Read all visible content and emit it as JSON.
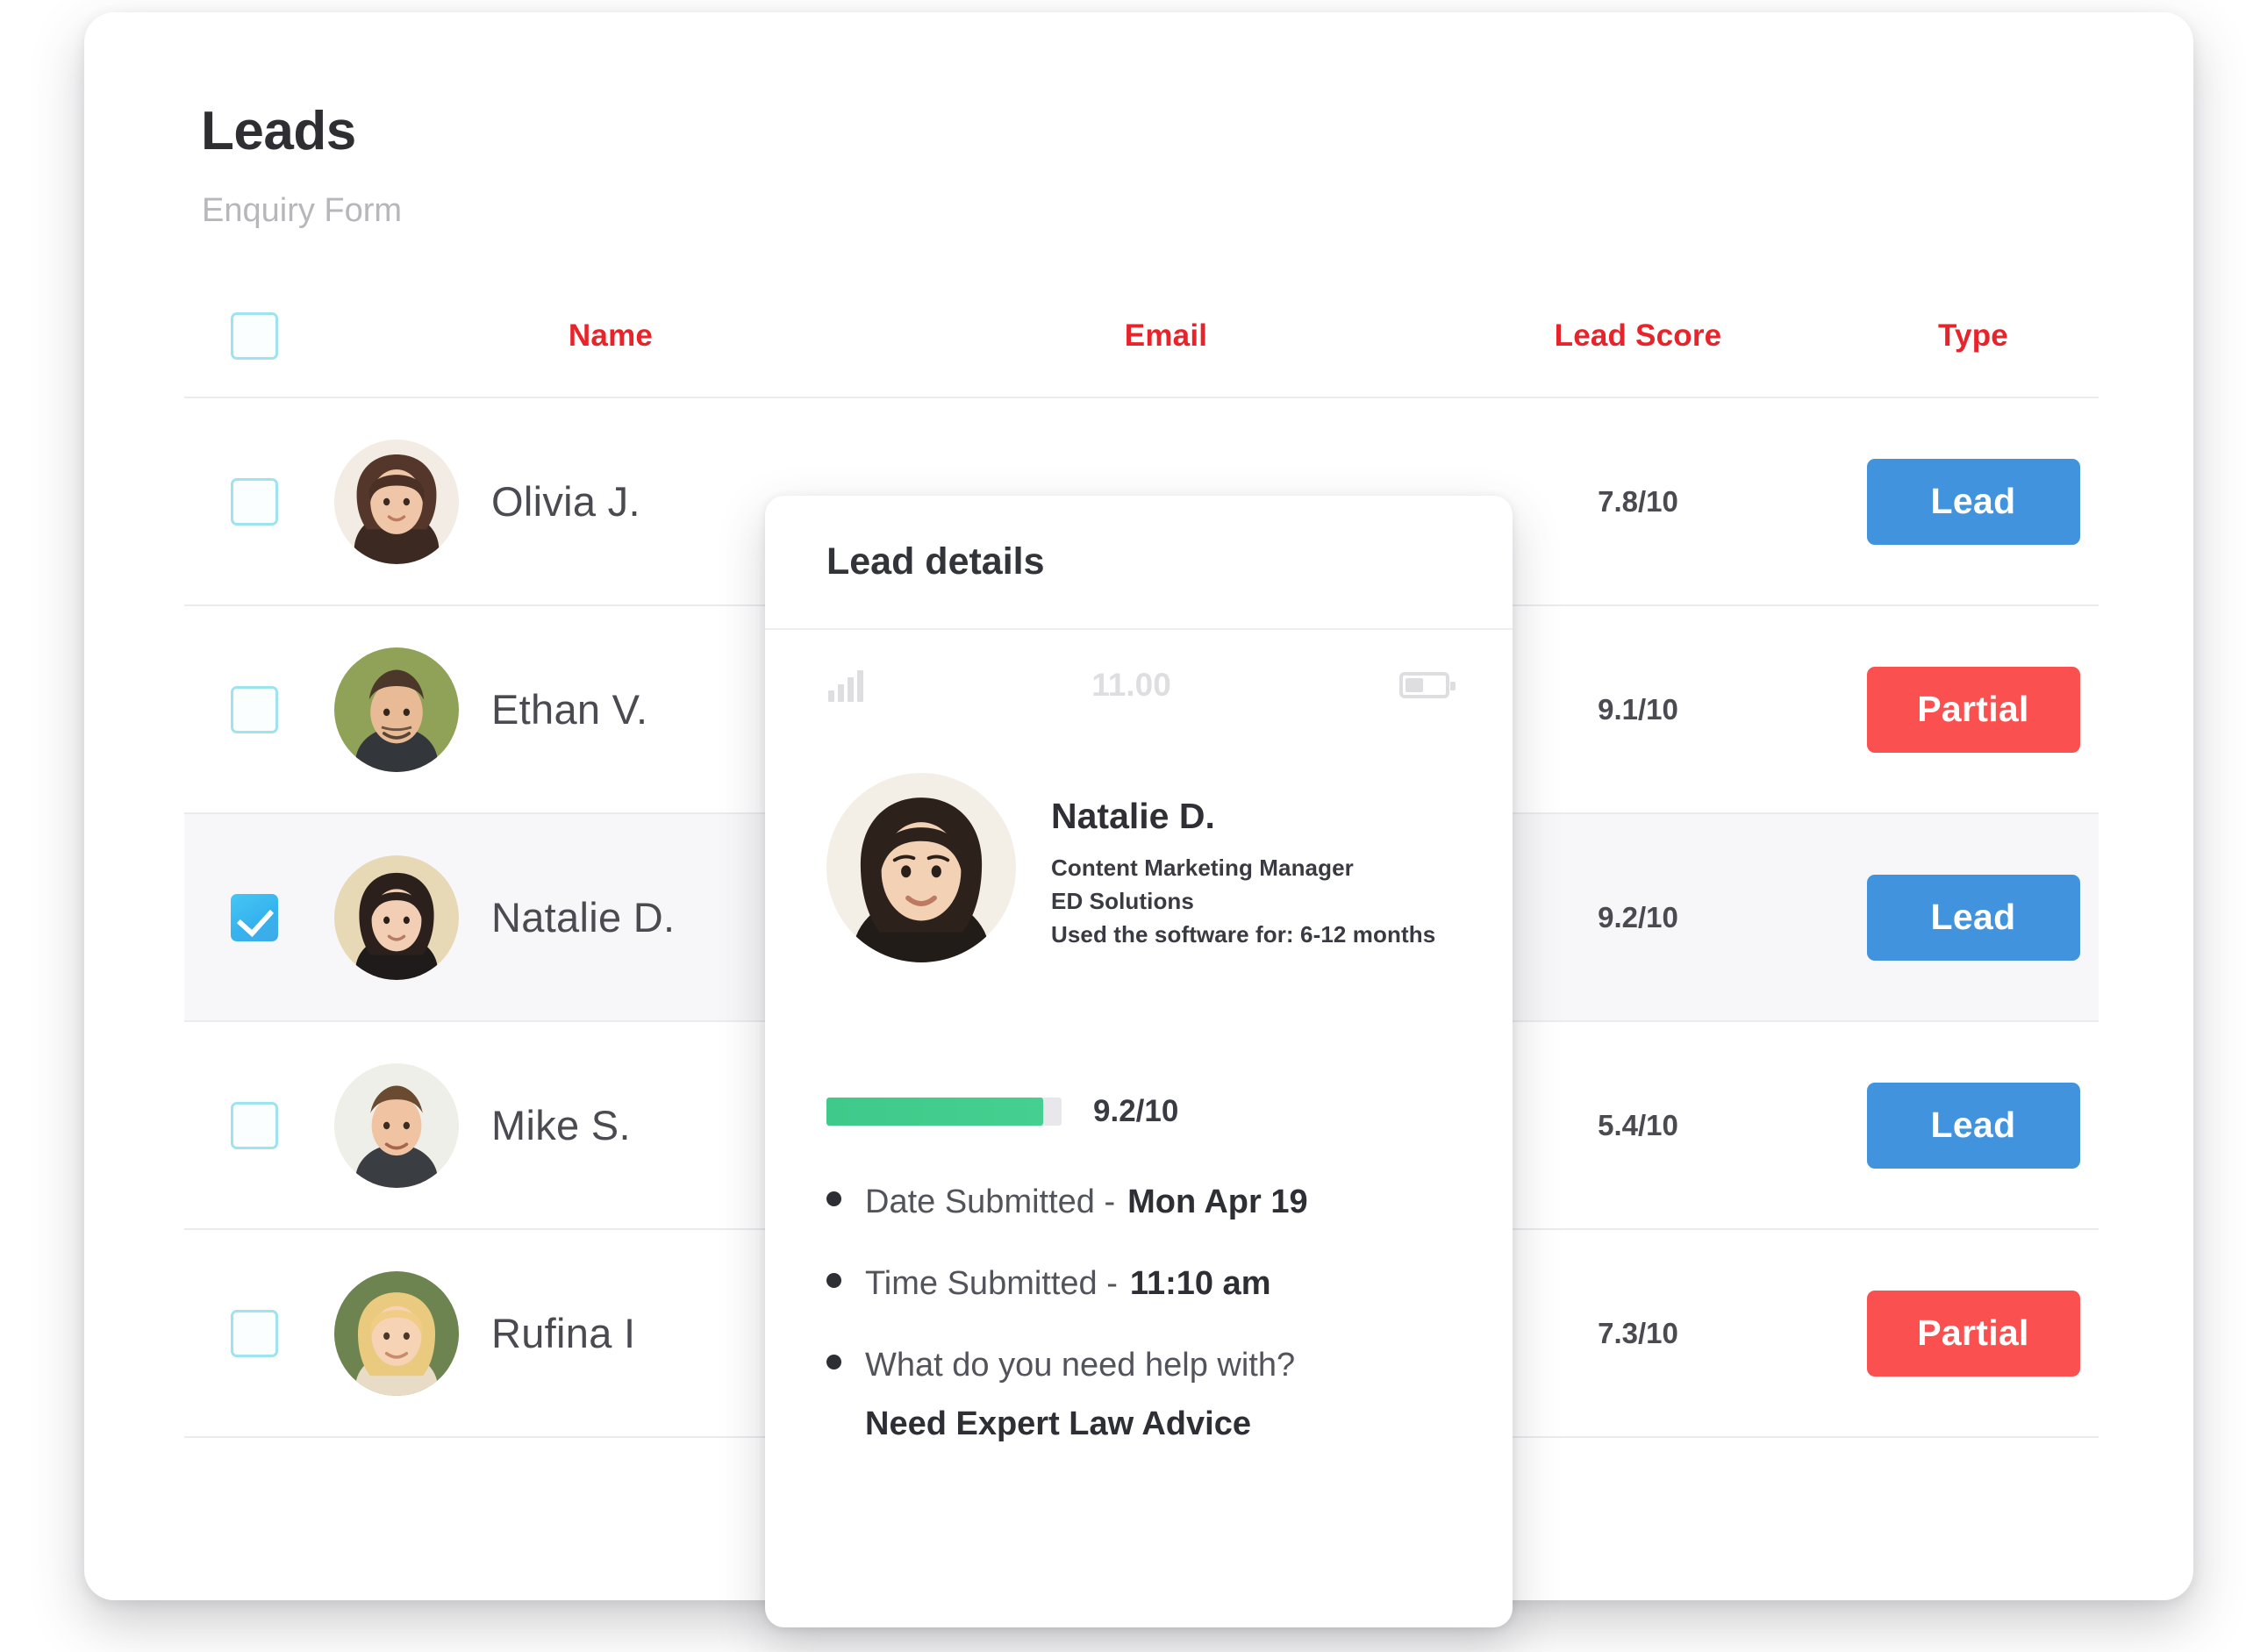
{
  "header": {
    "title": "Leads",
    "subtitle": "Enquiry Form"
  },
  "colors": {
    "header_text": "#e8232a",
    "badge_lead": "#4193dd",
    "badge_partial": "#fa5150",
    "checkbox_checked": "#36b3ee",
    "score_bar": "#3fc98a"
  },
  "table": {
    "columns": [
      "Name",
      "Email",
      "Lead Score",
      "Type"
    ],
    "select_all_checked": false,
    "rows": [
      {
        "name": "Olivia J.",
        "email": "",
        "score": "7.8/10",
        "type": "Lead",
        "checked": false,
        "selected": false
      },
      {
        "name": "Ethan V.",
        "email": "",
        "score": "9.1/10",
        "type": "Partial",
        "checked": false,
        "selected": false
      },
      {
        "name": "Natalie D.",
        "email": "",
        "score": "9.2/10",
        "type": "Lead",
        "checked": true,
        "selected": true
      },
      {
        "name": "Mike S.",
        "email": "",
        "score": "5.4/10",
        "type": "Lead",
        "checked": false,
        "selected": false
      },
      {
        "name": "Rufina I",
        "email": "",
        "score": "7.3/10",
        "type": "Partial",
        "checked": false,
        "selected": false
      }
    ]
  },
  "popup": {
    "title": "Lead details",
    "statusbar": {
      "time": "11.00"
    },
    "profile": {
      "name": "Natalie D.",
      "role": "Content Marketing Manager",
      "company": "ED Solutions",
      "usage": "Used the software for: 6-12 months"
    },
    "score": {
      "value": "9.2/10",
      "percent": 92
    },
    "details": [
      {
        "label": "Date Submitted -",
        "value": "Mon Apr 19"
      },
      {
        "label": "Time Submitted -",
        "value": "11:10 am"
      }
    ],
    "question": "What do you need help with?",
    "answer": "Need Expert Law Advice"
  }
}
